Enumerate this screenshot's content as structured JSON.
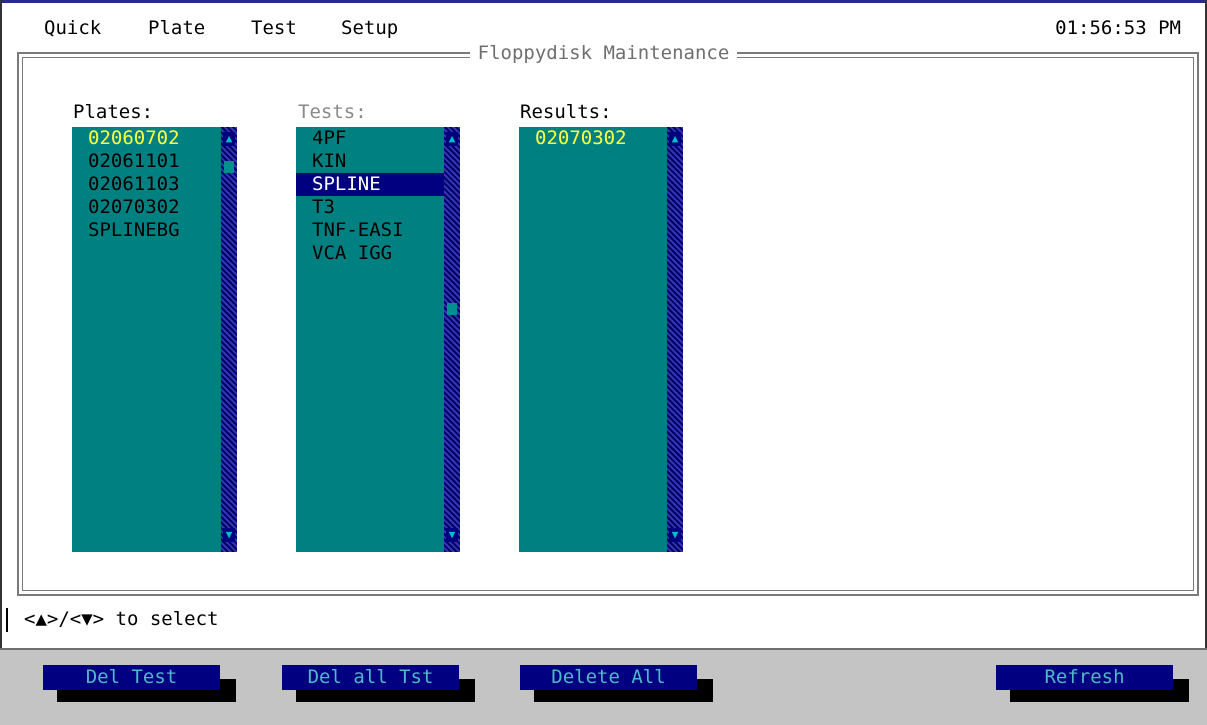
{
  "menu": {
    "items": [
      "Quick",
      "Plate",
      "Test",
      "Setup"
    ],
    "clock": "01:56:53 PM"
  },
  "frame": {
    "title": "Floppydisk Maintenance"
  },
  "plates": {
    "label": "Plates:",
    "items": [
      "02060702",
      "02061101",
      "02061103",
      "02070302",
      "SPLINEBG"
    ]
  },
  "tests": {
    "label": "Tests:",
    "items": [
      "4PF",
      "KIN",
      "SPLINE",
      "T3",
      "TNF-EASI",
      "VCA IGG"
    ],
    "selected": "SPLINE"
  },
  "results": {
    "label": "Results:",
    "items": [
      "02070302"
    ]
  },
  "status": {
    "hint": "<▲>/<▼> to select"
  },
  "buttons": {
    "del_test": "Del Test",
    "del_all_tst": "Del all Tst",
    "delete_all": "Delete All",
    "refresh": "Refresh"
  },
  "colors": {
    "list_bg": "#008080",
    "selection_bg": "#000080",
    "first_item_fg": "#ffff40",
    "button_bg": "#000080"
  }
}
